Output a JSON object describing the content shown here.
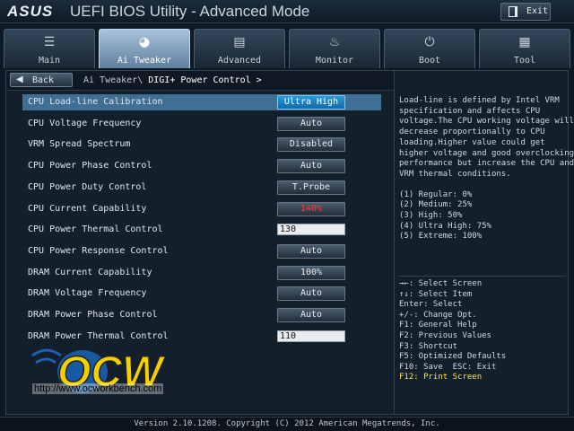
{
  "header": {
    "brand": "ASUS",
    "title": "UEFI BIOS Utility - Advanced Mode",
    "exit_label": "Exit"
  },
  "tabs": [
    {
      "label": "Main",
      "icon": "list-icon",
      "glyph": "☰",
      "active": false
    },
    {
      "label": "Ai Tweaker",
      "icon": "tweaker-icon",
      "glyph": "◕",
      "active": true
    },
    {
      "label": "Advanced",
      "icon": "advanced-icon",
      "glyph": "▤",
      "active": false
    },
    {
      "label": "Monitor",
      "icon": "monitor-icon",
      "glyph": "♨",
      "active": false
    },
    {
      "label": "Boot",
      "icon": "power-icon",
      "glyph": "⏻",
      "active": false
    },
    {
      "label": "Tool",
      "icon": "tool-icon",
      "glyph": "▦",
      "active": false
    }
  ],
  "nav": {
    "back_label": "Back",
    "breadcrumb_parent": "Ai Tweaker\\",
    "breadcrumb_current": "DIGI+ Power Control >"
  },
  "settings": [
    {
      "name": "CPU Load-line Calibration",
      "value": "Ultra High",
      "kind": "button",
      "selected": true
    },
    {
      "name": "CPU Voltage Frequency",
      "value": "Auto",
      "kind": "button"
    },
    {
      "name": "VRM Spread Spectrum",
      "value": "Disabled",
      "kind": "button"
    },
    {
      "name": "CPU Power Phase Control",
      "value": "Auto",
      "kind": "button"
    },
    {
      "name": "CPU Power Duty Control",
      "value": "T.Probe",
      "kind": "button"
    },
    {
      "name": "CPU Current Capability",
      "value": "140%",
      "kind": "button",
      "warn": true
    },
    {
      "name": "CPU Power Thermal Control",
      "value": "130",
      "kind": "input"
    },
    {
      "name": "CPU Power Response Control",
      "value": "Auto",
      "kind": "button"
    },
    {
      "name": "DRAM Current Capability",
      "value": "100%",
      "kind": "button"
    },
    {
      "name": "DRAM Voltage Frequency",
      "value": "Auto",
      "kind": "button"
    },
    {
      "name": "DRAM Power Phase Control",
      "value": "Auto",
      "kind": "button"
    },
    {
      "name": "DRAM Power Thermal Control",
      "value": "110",
      "kind": "input"
    }
  ],
  "help": {
    "description": [
      "Load-line is defined by Intel VRM",
      "specification and affects CPU",
      "voltage.The CPU working voltage will",
      "decrease proportionally to CPU",
      "loading.Higher value could get",
      "higher voltage and good overclocking",
      "performance but increase the CPU and",
      "VRM thermal conditions."
    ],
    "levels": [
      "(1) Regular: 0%",
      "(2) Medium: 25%",
      "(3) High: 50%",
      "(4) Ultra High: 75%",
      "(5) Extreme: 100%"
    ]
  },
  "keys": [
    "→←: Select Screen",
    "↑↓: Select Item",
    "Enter: Select",
    "+/-: Change Opt.",
    "F1: General Help",
    "F2: Previous Values",
    "F3: Shortcut",
    "F5: Optimized Defaults",
    "F10: Save  ESC: Exit",
    "F12: Print Screen"
  ],
  "watermark": {
    "logo_text": "OCW",
    "url": "http://www.ocworkbench.com"
  },
  "footer": {
    "text": "Version 2.10.1208. Copyright (C) 2012 American Megatrends, Inc."
  },
  "colors": {
    "accent": "#1f86c8",
    "selected_row": "#3f6f93",
    "warning": "#ff3b3b",
    "hotkey": "#ffe640"
  }
}
